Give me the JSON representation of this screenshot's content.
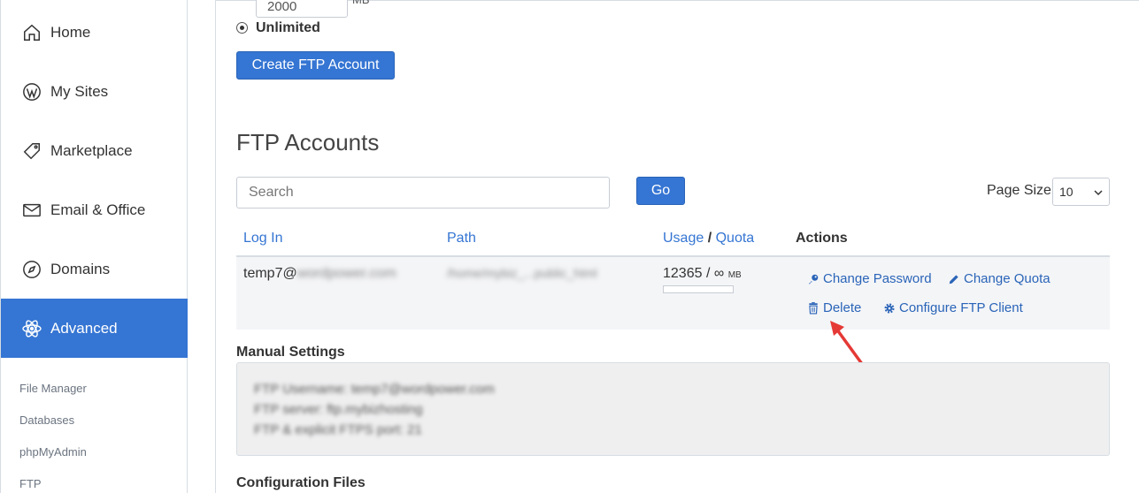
{
  "sidebar": {
    "items": [
      {
        "label": "Home",
        "icon": "home-icon"
      },
      {
        "label": "My Sites",
        "icon": "wordpress-icon"
      },
      {
        "label": "Marketplace",
        "icon": "tag-icon"
      },
      {
        "label": "Email & Office",
        "icon": "envelope-icon"
      },
      {
        "label": "Domains",
        "icon": "compass-icon"
      },
      {
        "label": "Advanced",
        "icon": "atom-icon",
        "active": true
      }
    ],
    "sub_items": [
      "File Manager",
      "Databases",
      "phpMyAdmin",
      "FTP"
    ]
  },
  "quota": {
    "value": "2000",
    "unit": "MB",
    "unlimited_label": "Unlimited"
  },
  "create_button": "Create FTP Account",
  "section_title": "FTP Accounts",
  "search": {
    "placeholder": "Search"
  },
  "go_button": "Go",
  "page_size": {
    "label": "Page Size",
    "value": "10"
  },
  "table": {
    "headers": {
      "login": "Log In",
      "path": "Path",
      "usage": "Usage",
      "sep": "/",
      "quota": "Quota",
      "actions": "Actions"
    },
    "row": {
      "login_prefix": "temp7@",
      "login_blurred": "wordpower.com",
      "path_blurred": "/home/mybiz_...public_html",
      "usage": "12365",
      "quota": "/ ∞",
      "unit": "MB"
    },
    "actions": {
      "change_password": "Change Password",
      "change_quota": "Change Quota",
      "delete": "Delete",
      "configure": "Configure FTP Client"
    }
  },
  "manual_settings": {
    "title": "Manual Settings",
    "lines": [
      "FTP Username: temp7@wordpower.com",
      "FTP server: ftp.mybizhosting",
      "FTP & explicit FTPS port: 21"
    ]
  },
  "config_files": {
    "title": "Configuration Files"
  },
  "colors": {
    "accent": "#3575d3",
    "annotation_arrow": "#e53935"
  }
}
